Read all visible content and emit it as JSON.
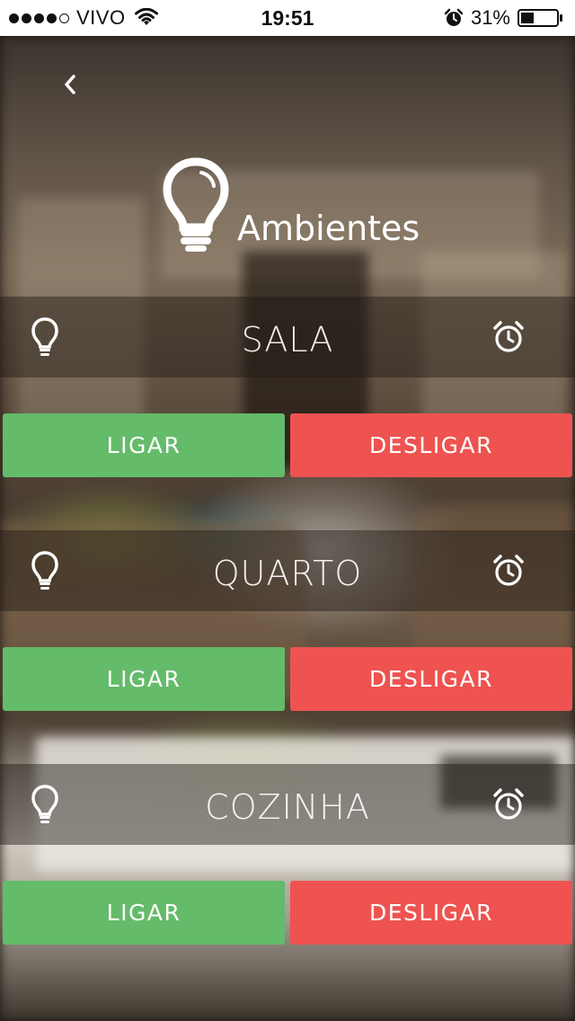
{
  "status_bar": {
    "carrier": "VIVO",
    "time": "19:51",
    "battery": "31%"
  },
  "header": {
    "title": "Ambientes"
  },
  "rooms": [
    {
      "name": "SALA",
      "on_label": "LIGAR",
      "off_label": "DESLIGAR"
    },
    {
      "name": "QUARTO",
      "on_label": "LIGAR",
      "off_label": "DESLIGAR"
    },
    {
      "name": "COZINHA",
      "on_label": "LIGAR",
      "off_label": "DESLIGAR"
    }
  ],
  "colors": {
    "on_button": "#64bb6a",
    "off_button": "#ee5350"
  },
  "icons": {
    "back": "chevron-left-icon",
    "logo": "lightbulb-icon",
    "room": "lightbulb-icon",
    "schedule": "alarm-clock-icon"
  }
}
